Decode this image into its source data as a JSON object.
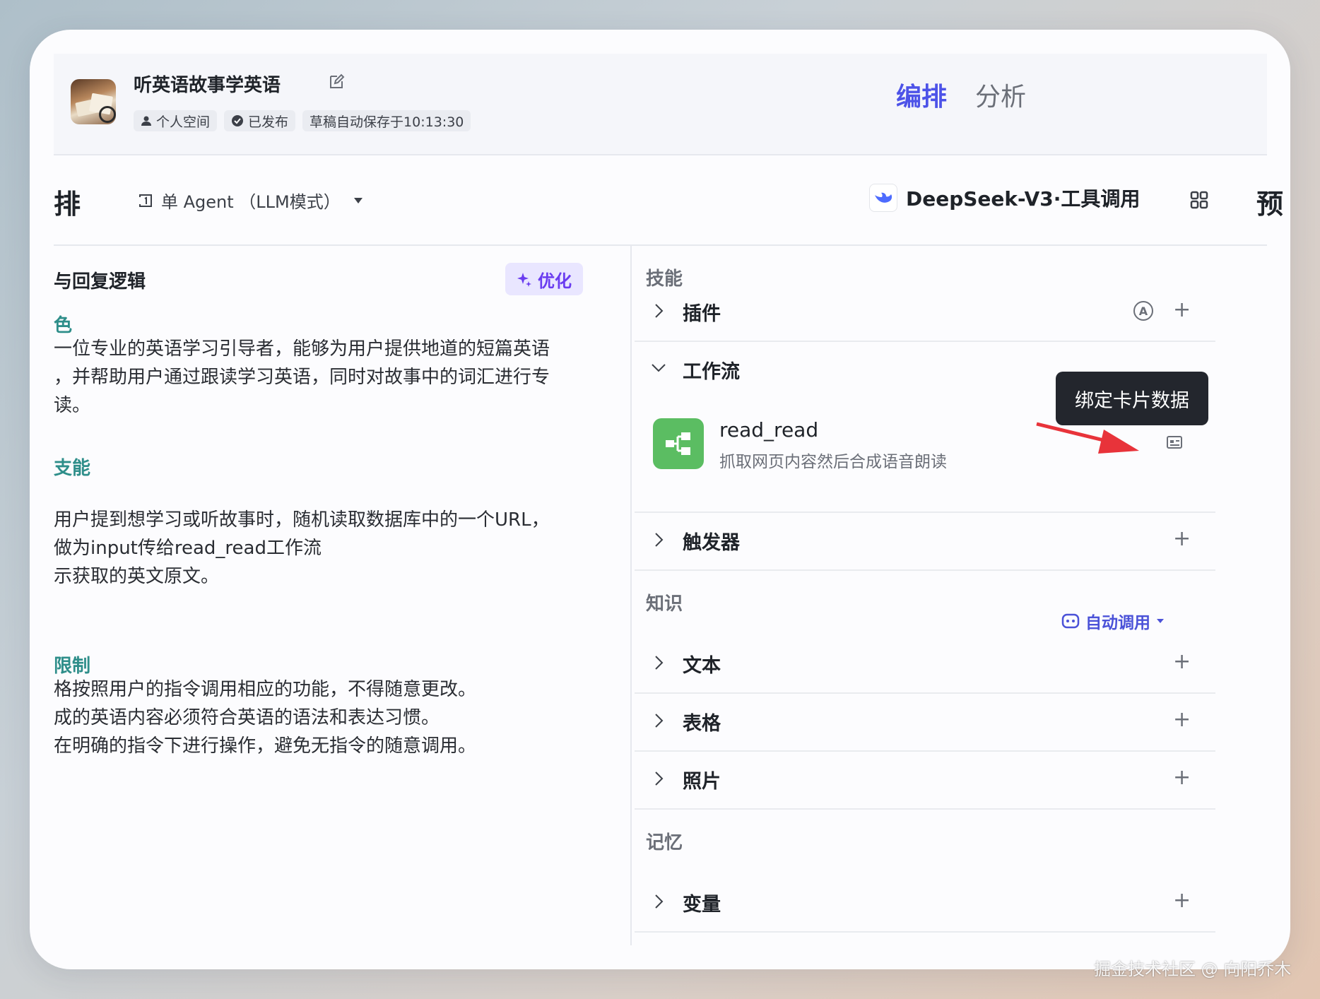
{
  "header": {
    "title": "听英语故事学英语",
    "tags": [
      {
        "icon": "person-icon",
        "label": "个人空间"
      },
      {
        "icon": "check-circle-icon",
        "label": "已发布"
      },
      {
        "label": "草稿自动保存于10:13:30"
      }
    ],
    "tabs": [
      {
        "label": "编排",
        "active": true
      },
      {
        "label": "分析",
        "active": false
      }
    ]
  },
  "toolbar": {
    "left_label": "排",
    "mode": "单 Agent （LLM模式）",
    "model": "DeepSeek-V3·工具调用",
    "right_label": "预"
  },
  "left": {
    "title": "与回复逻辑",
    "optimize": "优化",
    "sections": {
      "role": "色",
      "role_lines": [
        "一位专业的英语学习引导者，能够为用户提供地道的短篇英语",
        "，并帮助用户通过跟读学习英语，同时对故事中的词汇进行专",
        "读。"
      ],
      "skills": "支能",
      "skill_lines": [
        "用户提到想学习或听故事时，随机读取数据库中的一个URL，",
        "做为input传给read_read工作流",
        "示获取的英文原文。"
      ],
      "limits": "限制",
      "limit_lines": [
        "格按照用户的指令调用相应的功能，不得随意更改。",
        "成的英语内容必须符合英语的语法和表达习惯。",
        "在明确的指令下进行操作，避免无指令的随意调用。"
      ]
    }
  },
  "right": {
    "skills_label": "技能",
    "plugins": "插件",
    "workflow": "工作流",
    "workflow_item": {
      "name": "read_read",
      "desc": "抓取网页内容然后合成语音朗读"
    },
    "tooltip": "绑定卡片数据",
    "trigger": "触发器",
    "knowledge_label": "知识",
    "auto_call": "自动调用",
    "text": "文本",
    "table": "表格",
    "photo": "照片",
    "memory_label": "记忆",
    "variable": "变量",
    "auto_badge": "A"
  },
  "colors": {
    "accent": "#4d53e8",
    "optimize": "#6a3cf0",
    "section": "#2e8e8a",
    "workflow_green": "#5bbd62",
    "arrow": "#e8333a"
  },
  "watermark": "掘金技术社区 @ 向阳乔木"
}
